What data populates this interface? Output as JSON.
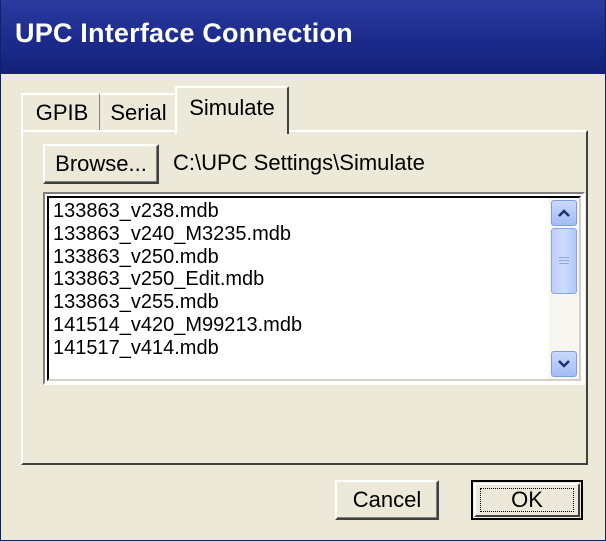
{
  "window": {
    "title": "UPC Interface Connection",
    "title_color": "#ffffff",
    "titlebar_color": "#1c2a8c",
    "background_color": "#ece9d8"
  },
  "tabs": [
    {
      "label": "GPIB",
      "selected": false
    },
    {
      "label": "Serial",
      "selected": false
    },
    {
      "label": "Simulate",
      "selected": true
    }
  ],
  "simulate": {
    "browse_label": "Browse...",
    "path": "C:\\UPC Settings\\Simulate",
    "files": [
      "133863_v238.mdb",
      "133863_v240_M3235.mdb",
      "133863_v250.mdb",
      "133863_v250_Edit.mdb",
      "133863_v255.mdb",
      "141514_v420_M99213.mdb",
      "141517_v414.mdb"
    ],
    "scrollbar": {
      "up_icon": "scroll-up-arrow",
      "down_icon": "scroll-down-arrow"
    }
  },
  "footer": {
    "cancel_label": "Cancel",
    "ok_label": "OK"
  }
}
